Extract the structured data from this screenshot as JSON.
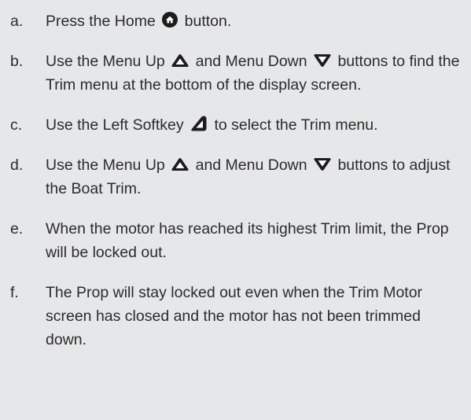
{
  "steps": [
    {
      "marker": "a.",
      "parts": [
        "Press the Home",
        "button."
      ],
      "icons": [
        "home-icon"
      ]
    },
    {
      "marker": "b.",
      "parts": [
        "Use the Menu Up",
        "and Menu Down",
        "buttons to find the Trim menu at the bottom of the display screen."
      ],
      "icons": [
        "menu-up-icon",
        "menu-down-icon"
      ]
    },
    {
      "marker": "c.",
      "parts": [
        "Use the Left Softkey",
        "to select the Trim menu."
      ],
      "icons": [
        "left-softkey-icon"
      ]
    },
    {
      "marker": "d.",
      "parts": [
        "Use the Menu Up",
        "and Menu Down",
        "buttons to adjust the Boat Trim."
      ],
      "icons": [
        "menu-up-icon",
        "menu-down-icon"
      ]
    },
    {
      "marker": "e.",
      "parts": [
        "When the motor has reached its highest Trim limit, the Prop will be locked out."
      ],
      "icons": []
    },
    {
      "marker": "f.",
      "parts": [
        "The Prop will stay locked out even when the Trim Motor screen has closed and the motor has not been trimmed down."
      ],
      "icons": []
    }
  ],
  "colors": {
    "background": "#e6e7e8",
    "text": "#2b2b2b",
    "icon_dark": "#1c1c1c",
    "icon_light": "#ffffff"
  }
}
